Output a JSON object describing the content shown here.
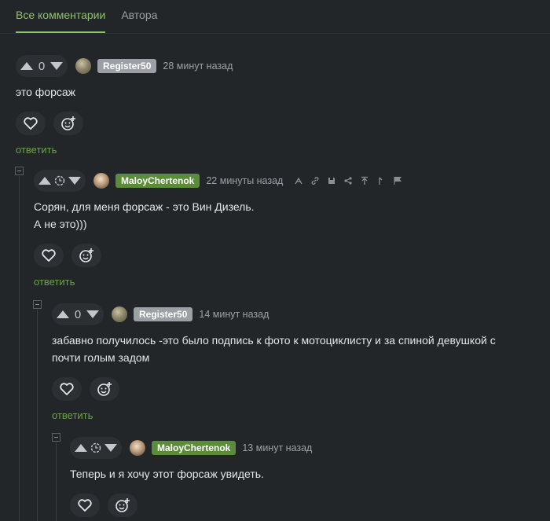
{
  "tabs": [
    {
      "label": "Все комментарии",
      "active": true
    },
    {
      "label": "Автора",
      "active": false
    }
  ],
  "comments": [
    {
      "score": "0",
      "nick": "Register50",
      "time": "28 минут назад",
      "text": [
        "это форсаж"
      ],
      "reply_label": "ответить"
    },
    {
      "score": "",
      "nick": "MaloyChertenok",
      "time": "22 минуты назад",
      "text": [
        "Сорян, для меня форсаж - это Вин Дизель.",
        "А не это)))"
      ],
      "reply_label": "ответить"
    },
    {
      "score": "0",
      "nick": "Register50",
      "time": "14 минут назад",
      "text": [
        "забавно получилось -это было подпись к фото к мотоциклисту и за спиной девушкой с",
        "почти голым задом"
      ],
      "reply_label": "ответить"
    },
    {
      "score": "",
      "nick": "MaloyChertenok",
      "time": "13 минут назад",
      "text": [
        "Теперь и я хочу этот форсаж увидеть."
      ]
    }
  ],
  "colors": {
    "background": "#232629",
    "accent": "#8dc26a",
    "reply": "#6ba34c",
    "nick_author": "#5b8c3a",
    "nick_other": "#9ba0a6"
  },
  "icons": [
    "upvote-icon",
    "downvote-icon",
    "clock-icon",
    "heart-icon",
    "emoji-add-icon",
    "link-icon",
    "save-icon",
    "share-icon",
    "up-arrow-icon",
    "flag-icon"
  ]
}
